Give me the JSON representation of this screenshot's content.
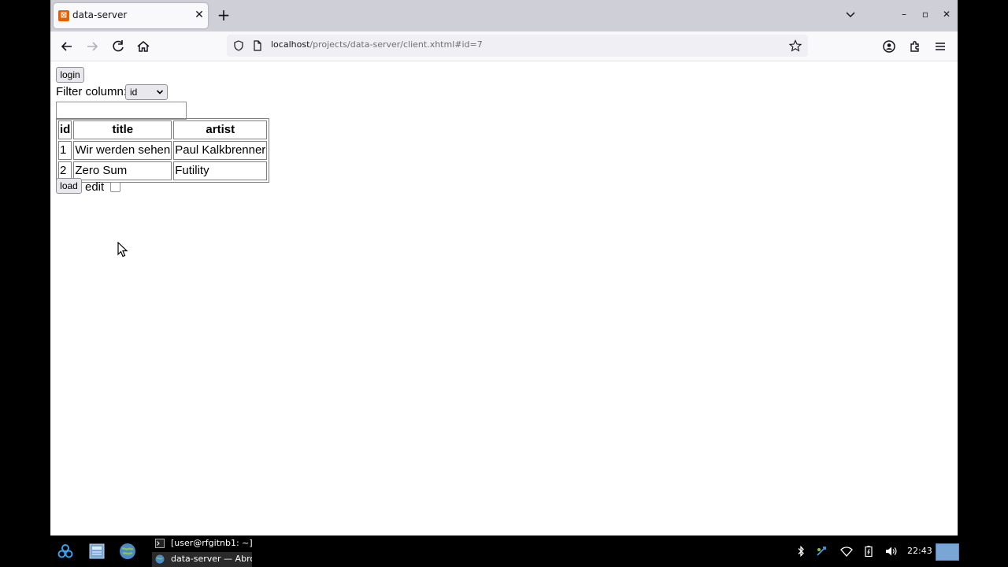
{
  "browser": {
    "tab": {
      "title": "data-server"
    },
    "url": {
      "host": "localhost",
      "path": "/projects/data-server/client.xhtml#id=7"
    }
  },
  "page": {
    "login_label": "login",
    "filter_label": "Filter column:",
    "filter_select_value": "id",
    "filter_input_value": "",
    "table": {
      "headers": [
        "id",
        "title",
        "artist"
      ],
      "rows": [
        [
          "1",
          "Wir werden sehen",
          "Paul Kalkbrenner"
        ],
        [
          "2",
          "Zero Sum",
          "Futility"
        ]
      ]
    },
    "load_label": "load",
    "edit_label": "edit",
    "edit_checked": false
  },
  "taskbar": {
    "tasks": [
      {
        "label": "[user@rfgitnb1: ~]"
      },
      {
        "label": "data-server — Abro..."
      }
    ],
    "clock": "22:43"
  },
  "colors": {
    "tab_favicon": "#e66000",
    "taskbar_bg": "#000000",
    "page_bg": "#ffffff"
  }
}
